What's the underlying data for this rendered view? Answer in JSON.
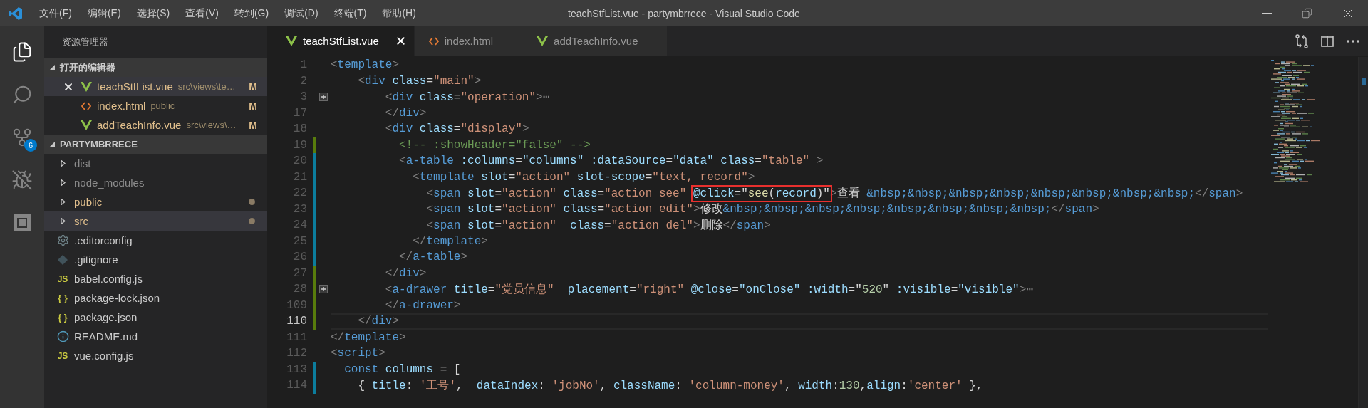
{
  "title_bar": {
    "menu": [
      "文件(F)",
      "编辑(E)",
      "选择(S)",
      "查看(V)",
      "转到(G)",
      "调试(D)",
      "终端(T)",
      "帮助(H)"
    ],
    "title": "teachStfList.vue - partymbrrece - Visual Studio Code"
  },
  "activity_bar": {
    "items": [
      {
        "kind": "files",
        "selected": true
      },
      {
        "kind": "search",
        "selected": false
      },
      {
        "kind": "source_control",
        "selected": false,
        "badge": "6"
      },
      {
        "kind": "debug",
        "selected": false
      },
      {
        "kind": "extensions",
        "selected": false
      }
    ]
  },
  "sidebar": {
    "title": "资源管理器",
    "open_editors": {
      "label": "打开的编辑器",
      "expanded": true,
      "items": [
        {
          "name": "teachStfList.vue",
          "path": "src\\views\\te…",
          "kind": "vue",
          "status": "M",
          "selected": true
        },
        {
          "name": "index.html",
          "path": "public",
          "kind": "html",
          "status": "M",
          "selected": false
        },
        {
          "name": "addTeachInfo.vue",
          "path": "src\\views\\…",
          "kind": "vue",
          "status": "M",
          "selected": false
        }
      ]
    },
    "folder": {
      "label": "PARTYMBRRECE",
      "expanded": true,
      "items": [
        {
          "name": "dist",
          "kind": "folder",
          "ignored": true,
          "modified": false,
          "selected": false
        },
        {
          "name": "node_modules",
          "kind": "folder",
          "ignored": true,
          "modified": false,
          "selected": false
        },
        {
          "name": "public",
          "kind": "folder",
          "ignored": false,
          "modified": true,
          "selected": false
        },
        {
          "name": "src",
          "kind": "folder",
          "ignored": false,
          "modified": true,
          "selected": true
        },
        {
          "name": ".editorconfig",
          "kind": "gear",
          "ignored": false,
          "modified": false,
          "selected": false
        },
        {
          "name": ".gitignore",
          "kind": "git",
          "ignored": false,
          "modified": false,
          "selected": false
        },
        {
          "name": "babel.config.js",
          "kind": "js",
          "glyph": "JS",
          "ignored": false,
          "modified": false,
          "selected": false
        },
        {
          "name": "package-lock.json",
          "kind": "json",
          "glyph": "{ }",
          "ignored": false,
          "modified": false,
          "selected": false
        },
        {
          "name": "package.json",
          "kind": "json",
          "glyph": "{ }",
          "ignored": false,
          "modified": false,
          "selected": false
        },
        {
          "name": "README.md",
          "kind": "info",
          "ignored": false,
          "modified": false,
          "selected": false
        },
        {
          "name": "vue.config.js",
          "kind": "js",
          "glyph": "JS",
          "ignored": false,
          "modified": false,
          "selected": false
        }
      ]
    }
  },
  "editor": {
    "tabs": [
      {
        "label": "teachStfList.vue",
        "kind": "vue",
        "selected": true
      },
      {
        "label": "index.html",
        "kind": "html",
        "selected": false
      },
      {
        "label": "addTeachInfo.vue",
        "kind": "vue",
        "selected": false
      }
    ],
    "lines": [
      {
        "number": "1",
        "folded": false,
        "current": false,
        "tokens": [
          {
            "kind": "punct",
            "text": "<"
          },
          {
            "kind": "tag",
            "text": "template"
          },
          {
            "kind": "punct",
            "text": ">"
          }
        ]
      },
      {
        "number": "2",
        "folded": false,
        "current": false,
        "tokens": [
          {
            "kind": "punct",
            "text": "    <"
          },
          {
            "kind": "tag",
            "text": "div"
          },
          {
            "kind": "attr",
            "text": " class"
          },
          {
            "kind": "text",
            "text": "="
          },
          {
            "kind": "string",
            "text": "\"main\""
          },
          {
            "kind": "punct",
            "text": ">"
          }
        ]
      },
      {
        "number": "3",
        "folded": true,
        "current": false,
        "tokens": [
          {
            "kind": "punct",
            "text": "        <"
          },
          {
            "kind": "tag",
            "text": "div"
          },
          {
            "kind": "attr",
            "text": " class"
          },
          {
            "kind": "text",
            "text": "="
          },
          {
            "kind": "string",
            "text": "\"operation\""
          },
          {
            "kind": "punct",
            "text": ">"
          },
          {
            "kind": "ellipsis",
            "text": "⋯"
          }
        ]
      },
      {
        "number": "17",
        "folded": false,
        "current": false,
        "tokens": [
          {
            "kind": "punct",
            "text": "        </"
          },
          {
            "kind": "tag",
            "text": "div"
          },
          {
            "kind": "punct",
            "text": ">"
          }
        ]
      },
      {
        "number": "18",
        "folded": false,
        "current": false,
        "tokens": [
          {
            "kind": "punct",
            "text": "        <"
          },
          {
            "kind": "tag",
            "text": "div"
          },
          {
            "kind": "attr",
            "text": " class"
          },
          {
            "kind": "text",
            "text": "="
          },
          {
            "kind": "string",
            "text": "\"display\""
          },
          {
            "kind": "punct",
            "text": ">"
          }
        ]
      },
      {
        "number": "19",
        "color": "#587c0c",
        "folded": false,
        "current": false,
        "tokens": [
          {
            "kind": "comment",
            "text": "          <!-- :showHeader=\"false\" -->"
          }
        ]
      },
      {
        "number": "20",
        "color": "#0c7d9d",
        "folded": false,
        "current": false,
        "tokens": [
          {
            "kind": "punct",
            "text": "          <"
          },
          {
            "kind": "tag",
            "text": "a-table"
          },
          {
            "kind": "attr",
            "text": " :columns"
          },
          {
            "kind": "text",
            "text": "="
          },
          {
            "kind": "expr",
            "text": "\"columns\""
          },
          {
            "kind": "attr",
            "text": " :dataSource"
          },
          {
            "kind": "text",
            "text": "="
          },
          {
            "kind": "expr",
            "text": "\"data\""
          },
          {
            "kind": "attr",
            "text": " class"
          },
          {
            "kind": "text",
            "text": "="
          },
          {
            "kind": "string",
            "text": "\"table\""
          },
          {
            "kind": "punct",
            "text": " >"
          }
        ]
      },
      {
        "number": "21",
        "color": "#0c7d9d",
        "folded": false,
        "current": false,
        "tokens": [
          {
            "kind": "punct",
            "text": "            <"
          },
          {
            "kind": "tag",
            "text": "template"
          },
          {
            "kind": "attr",
            "text": " slot"
          },
          {
            "kind": "text",
            "text": "="
          },
          {
            "kind": "string",
            "text": "\"action\""
          },
          {
            "kind": "attr",
            "text": " slot-scope"
          },
          {
            "kind": "text",
            "text": "="
          },
          {
            "kind": "string",
            "text": "\"text, record\""
          },
          {
            "kind": "punct",
            "text": ">"
          }
        ]
      },
      {
        "number": "22",
        "color": "#0c7d9d",
        "folded": false,
        "current": false,
        "tokens": [
          {
            "kind": "punct",
            "text": "              <"
          },
          {
            "kind": "tag",
            "text": "span"
          },
          {
            "kind": "attr",
            "text": " slot"
          },
          {
            "kind": "text",
            "text": "="
          },
          {
            "kind": "string",
            "text": "\"action\""
          },
          {
            "kind": "attr",
            "text": " class"
          },
          {
            "kind": "text",
            "text": "="
          },
          {
            "kind": "string",
            "text": "\"action see\" "
          },
          {
            "kind": "box",
            "tokens": [
              {
                "kind": "attr",
                "text": "@click"
              },
              {
                "kind": "text",
                "text": "=\""
              },
              {
                "kind": "func",
                "text": "see"
              },
              {
                "kind": "text",
                "text": "("
              },
              {
                "kind": "expr",
                "text": "record"
              },
              {
                "kind": "text",
                "text": ")\""
              }
            ]
          },
          {
            "kind": "punct",
            "text": ">"
          },
          {
            "kind": "text",
            "text": "查看 "
          },
          {
            "kind": "entity",
            "text": "&nbsp;&nbsp;&nbsp;&nbsp;&nbsp;&nbsp;&nbsp;&nbsp;"
          },
          {
            "kind": "punct",
            "text": "</"
          },
          {
            "kind": "tag",
            "text": "span"
          },
          {
            "kind": "punct",
            "text": ">"
          }
        ]
      },
      {
        "number": "23",
        "color": "#0c7d9d",
        "folded": false,
        "current": false,
        "tokens": [
          {
            "kind": "punct",
            "text": "              <"
          },
          {
            "kind": "tag",
            "text": "span"
          },
          {
            "kind": "attr",
            "text": " slot"
          },
          {
            "kind": "text",
            "text": "="
          },
          {
            "kind": "string",
            "text": "\"action\""
          },
          {
            "kind": "attr",
            "text": " class"
          },
          {
            "kind": "text",
            "text": "="
          },
          {
            "kind": "string",
            "text": "\"action edit\""
          },
          {
            "kind": "punct",
            "text": ">"
          },
          {
            "kind": "text",
            "text": "修改"
          },
          {
            "kind": "entity",
            "text": "&nbsp;&nbsp;&nbsp;&nbsp;&nbsp;&nbsp;&nbsp;&nbsp;"
          },
          {
            "kind": "punct",
            "text": "</"
          },
          {
            "kind": "tag",
            "text": "span"
          },
          {
            "kind": "punct",
            "text": ">"
          }
        ]
      },
      {
        "number": "24",
        "color": "#0c7d9d",
        "folded": false,
        "current": false,
        "tokens": [
          {
            "kind": "punct",
            "text": "              <"
          },
          {
            "kind": "tag",
            "text": "span"
          },
          {
            "kind": "attr",
            "text": " slot"
          },
          {
            "kind": "text",
            "text": "="
          },
          {
            "kind": "string",
            "text": "\"action\""
          },
          {
            "kind": "attr",
            "text": "  class"
          },
          {
            "kind": "text",
            "text": "="
          },
          {
            "kind": "string",
            "text": "\"action del\""
          },
          {
            "kind": "punct",
            "text": ">"
          },
          {
            "kind": "text",
            "text": "删除"
          },
          {
            "kind": "punct",
            "text": "</"
          },
          {
            "kind": "tag",
            "text": "span"
          },
          {
            "kind": "punct",
            "text": ">"
          }
        ]
      },
      {
        "number": "25",
        "color": "#0c7d9d",
        "folded": false,
        "current": false,
        "tokens": [
          {
            "kind": "punct",
            "text": "            </"
          },
          {
            "kind": "tag",
            "text": "template"
          },
          {
            "kind": "punct",
            "text": ">"
          }
        ]
      },
      {
        "number": "26",
        "color": "#0c7d9d",
        "folded": false,
        "current": false,
        "tokens": [
          {
            "kind": "punct",
            "text": "          </"
          },
          {
            "kind": "tag",
            "text": "a-table"
          },
          {
            "kind": "punct",
            "text": ">"
          }
        ]
      },
      {
        "number": "27",
        "color": "#587c0c",
        "folded": false,
        "current": false,
        "tokens": [
          {
            "kind": "punct",
            "text": "        </"
          },
          {
            "kind": "tag",
            "text": "div"
          },
          {
            "kind": "punct",
            "text": ">"
          }
        ]
      },
      {
        "number": "28",
        "color": "#587c0c",
        "folded": true,
        "current": false,
        "tokens": [
          {
            "kind": "punct",
            "text": "        <"
          },
          {
            "kind": "tag",
            "text": "a-drawer"
          },
          {
            "kind": "attr",
            "text": " title"
          },
          {
            "kind": "text",
            "text": "="
          },
          {
            "kind": "string",
            "text": "\"党员信息\""
          },
          {
            "kind": "attr",
            "text": "  placement"
          },
          {
            "kind": "text",
            "text": "="
          },
          {
            "kind": "string",
            "text": "\"right\""
          },
          {
            "kind": "attr",
            "text": " @close"
          },
          {
            "kind": "text",
            "text": "="
          },
          {
            "kind": "expr",
            "text": "\"onClose\""
          },
          {
            "kind": "attr",
            "text": " :width"
          },
          {
            "kind": "text",
            "text": "=\""
          },
          {
            "kind": "number",
            "text": "520"
          },
          {
            "kind": "text",
            "text": "\""
          },
          {
            "kind": "attr",
            "text": " :visible"
          },
          {
            "kind": "text",
            "text": "="
          },
          {
            "kind": "expr",
            "text": "\"visible\""
          },
          {
            "kind": "punct",
            "text": ">"
          },
          {
            "kind": "ellipsis",
            "text": "⋯"
          }
        ]
      },
      {
        "number": "109",
        "color": "#587c0c",
        "folded": false,
        "current": false,
        "tokens": [
          {
            "kind": "punct",
            "text": "        </"
          },
          {
            "kind": "tag",
            "text": "a-drawer"
          },
          {
            "kind": "punct",
            "text": ">"
          }
        ]
      },
      {
        "number": "110",
        "color": "#587c0c",
        "folded": false,
        "current": true,
        "tokens": [
          {
            "kind": "punct",
            "text": "    </"
          },
          {
            "kind": "tag",
            "text": "div"
          },
          {
            "kind": "punct",
            "text": ">"
          }
        ]
      },
      {
        "number": "111",
        "folded": false,
        "current": false,
        "tokens": [
          {
            "kind": "punct",
            "text": "</"
          },
          {
            "kind": "tag",
            "text": "template"
          },
          {
            "kind": "punct",
            "text": ">"
          }
        ]
      },
      {
        "number": "112",
        "folded": false,
        "current": false,
        "tokens": [
          {
            "kind": "punct",
            "text": "<"
          },
          {
            "kind": "tag",
            "text": "script"
          },
          {
            "kind": "punct",
            "text": ">"
          }
        ]
      },
      {
        "number": "113",
        "color": "#0c7d9d",
        "folded": false,
        "current": false,
        "tokens": [
          {
            "kind": "keyword",
            "text": "  const"
          },
          {
            "kind": "expr",
            "text": " columns"
          },
          {
            "kind": "text",
            "text": " = ["
          }
        ]
      },
      {
        "number": "114",
        "color": "#0c7d9d",
        "folded": false,
        "current": false,
        "tokens": [
          {
            "kind": "text",
            "text": "    { "
          },
          {
            "kind": "expr",
            "text": "title"
          },
          {
            "kind": "text",
            "text": ": "
          },
          {
            "kind": "string",
            "text": "'工号'"
          },
          {
            "kind": "text",
            "text": ",  "
          },
          {
            "kind": "expr",
            "text": "dataIndex"
          },
          {
            "kind": "text",
            "text": ": "
          },
          {
            "kind": "string",
            "text": "'jobNo'"
          },
          {
            "kind": "text",
            "text": ", "
          },
          {
            "kind": "expr",
            "text": "className"
          },
          {
            "kind": "text",
            "text": ": "
          },
          {
            "kind": "string",
            "text": "'column-money'"
          },
          {
            "kind": "text",
            "text": ", "
          },
          {
            "kind": "expr",
            "text": "width"
          },
          {
            "kind": "text",
            "text": ":"
          },
          {
            "kind": "number",
            "text": "130"
          },
          {
            "kind": "text",
            "text": ","
          },
          {
            "kind": "expr",
            "text": "align"
          },
          {
            "kind": "text",
            "text": ":"
          },
          {
            "kind": "string",
            "text": "'center'"
          },
          {
            "kind": "text",
            "text": " },"
          }
        ]
      }
    ]
  }
}
